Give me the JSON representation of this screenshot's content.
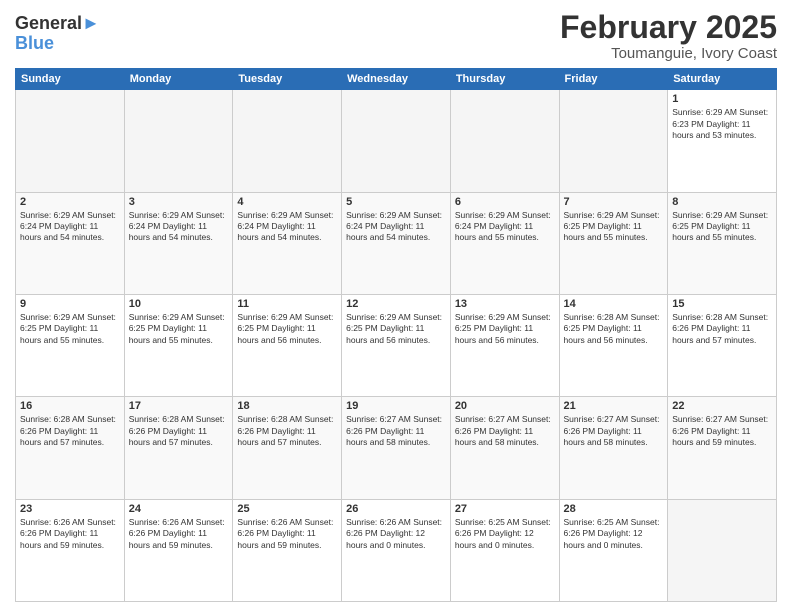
{
  "logo": {
    "line1": "General",
    "line2": "Blue"
  },
  "header": {
    "month": "February 2025",
    "location": "Toumanguie, Ivory Coast"
  },
  "weekdays": [
    "Sunday",
    "Monday",
    "Tuesday",
    "Wednesday",
    "Thursday",
    "Friday",
    "Saturday"
  ],
  "weeks": [
    [
      {
        "day": "",
        "text": "",
        "empty": true
      },
      {
        "day": "",
        "text": "",
        "empty": true
      },
      {
        "day": "",
        "text": "",
        "empty": true
      },
      {
        "day": "",
        "text": "",
        "empty": true
      },
      {
        "day": "",
        "text": "",
        "empty": true
      },
      {
        "day": "",
        "text": "",
        "empty": true
      },
      {
        "day": "1",
        "text": "Sunrise: 6:29 AM\nSunset: 6:23 PM\nDaylight: 11 hours\nand 53 minutes.",
        "empty": false
      }
    ],
    [
      {
        "day": "2",
        "text": "Sunrise: 6:29 AM\nSunset: 6:24 PM\nDaylight: 11 hours\nand 54 minutes.",
        "empty": false
      },
      {
        "day": "3",
        "text": "Sunrise: 6:29 AM\nSunset: 6:24 PM\nDaylight: 11 hours\nand 54 minutes.",
        "empty": false
      },
      {
        "day": "4",
        "text": "Sunrise: 6:29 AM\nSunset: 6:24 PM\nDaylight: 11 hours\nand 54 minutes.",
        "empty": false
      },
      {
        "day": "5",
        "text": "Sunrise: 6:29 AM\nSunset: 6:24 PM\nDaylight: 11 hours\nand 54 minutes.",
        "empty": false
      },
      {
        "day": "6",
        "text": "Sunrise: 6:29 AM\nSunset: 6:24 PM\nDaylight: 11 hours\nand 55 minutes.",
        "empty": false
      },
      {
        "day": "7",
        "text": "Sunrise: 6:29 AM\nSunset: 6:25 PM\nDaylight: 11 hours\nand 55 minutes.",
        "empty": false
      },
      {
        "day": "8",
        "text": "Sunrise: 6:29 AM\nSunset: 6:25 PM\nDaylight: 11 hours\nand 55 minutes.",
        "empty": false
      }
    ],
    [
      {
        "day": "9",
        "text": "Sunrise: 6:29 AM\nSunset: 6:25 PM\nDaylight: 11 hours\nand 55 minutes.",
        "empty": false
      },
      {
        "day": "10",
        "text": "Sunrise: 6:29 AM\nSunset: 6:25 PM\nDaylight: 11 hours\nand 55 minutes.",
        "empty": false
      },
      {
        "day": "11",
        "text": "Sunrise: 6:29 AM\nSunset: 6:25 PM\nDaylight: 11 hours\nand 56 minutes.",
        "empty": false
      },
      {
        "day": "12",
        "text": "Sunrise: 6:29 AM\nSunset: 6:25 PM\nDaylight: 11 hours\nand 56 minutes.",
        "empty": false
      },
      {
        "day": "13",
        "text": "Sunrise: 6:29 AM\nSunset: 6:25 PM\nDaylight: 11 hours\nand 56 minutes.",
        "empty": false
      },
      {
        "day": "14",
        "text": "Sunrise: 6:28 AM\nSunset: 6:25 PM\nDaylight: 11 hours\nand 56 minutes.",
        "empty": false
      },
      {
        "day": "15",
        "text": "Sunrise: 6:28 AM\nSunset: 6:26 PM\nDaylight: 11 hours\nand 57 minutes.",
        "empty": false
      }
    ],
    [
      {
        "day": "16",
        "text": "Sunrise: 6:28 AM\nSunset: 6:26 PM\nDaylight: 11 hours\nand 57 minutes.",
        "empty": false
      },
      {
        "day": "17",
        "text": "Sunrise: 6:28 AM\nSunset: 6:26 PM\nDaylight: 11 hours\nand 57 minutes.",
        "empty": false
      },
      {
        "day": "18",
        "text": "Sunrise: 6:28 AM\nSunset: 6:26 PM\nDaylight: 11 hours\nand 57 minutes.",
        "empty": false
      },
      {
        "day": "19",
        "text": "Sunrise: 6:27 AM\nSunset: 6:26 PM\nDaylight: 11 hours\nand 58 minutes.",
        "empty": false
      },
      {
        "day": "20",
        "text": "Sunrise: 6:27 AM\nSunset: 6:26 PM\nDaylight: 11 hours\nand 58 minutes.",
        "empty": false
      },
      {
        "day": "21",
        "text": "Sunrise: 6:27 AM\nSunset: 6:26 PM\nDaylight: 11 hours\nand 58 minutes.",
        "empty": false
      },
      {
        "day": "22",
        "text": "Sunrise: 6:27 AM\nSunset: 6:26 PM\nDaylight: 11 hours\nand 59 minutes.",
        "empty": false
      }
    ],
    [
      {
        "day": "23",
        "text": "Sunrise: 6:26 AM\nSunset: 6:26 PM\nDaylight: 11 hours\nand 59 minutes.",
        "empty": false
      },
      {
        "day": "24",
        "text": "Sunrise: 6:26 AM\nSunset: 6:26 PM\nDaylight: 11 hours\nand 59 minutes.",
        "empty": false
      },
      {
        "day": "25",
        "text": "Sunrise: 6:26 AM\nSunset: 6:26 PM\nDaylight: 11 hours\nand 59 minutes.",
        "empty": false
      },
      {
        "day": "26",
        "text": "Sunrise: 6:26 AM\nSunset: 6:26 PM\nDaylight: 12 hours\nand 0 minutes.",
        "empty": false
      },
      {
        "day": "27",
        "text": "Sunrise: 6:25 AM\nSunset: 6:26 PM\nDaylight: 12 hours\nand 0 minutes.",
        "empty": false
      },
      {
        "day": "28",
        "text": "Sunrise: 6:25 AM\nSunset: 6:26 PM\nDaylight: 12 hours\nand 0 minutes.",
        "empty": false
      },
      {
        "day": "",
        "text": "",
        "empty": true
      }
    ]
  ]
}
